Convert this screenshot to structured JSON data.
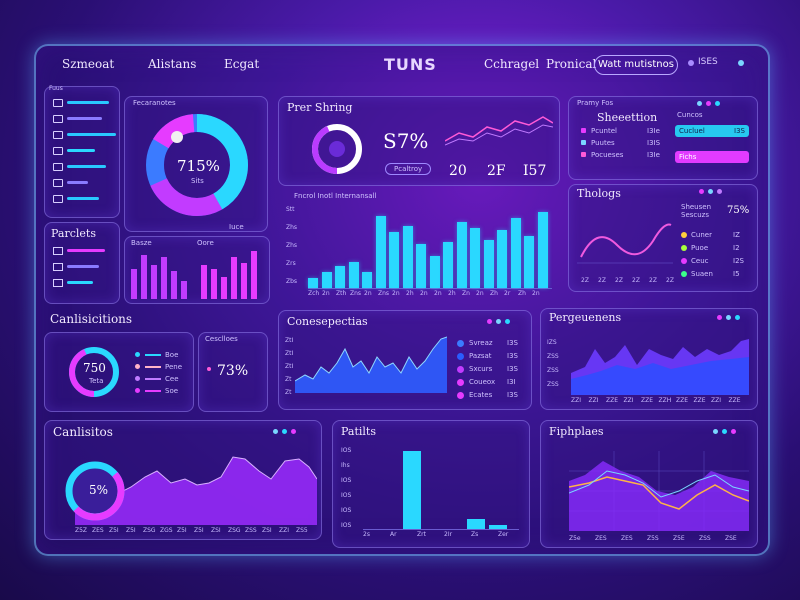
{
  "nav": {
    "left": [
      "Szmeoat",
      "Alistans",
      "Ecgat"
    ],
    "brand": "TUNS",
    "right": [
      "Cchragel",
      "Pronical"
    ],
    "button": "Watt mutistnos",
    "mini": "ISES"
  },
  "sidebar": {
    "items": [
      "",
      "",
      "",
      "",
      "",
      "",
      ""
    ],
    "title": "Fuus"
  },
  "donut_panel": {
    "title": "Fecaranotes",
    "value": "715%",
    "sub": "Sits",
    "foot": "Iuce"
  },
  "revenue_panel": {
    "title": "Prer Shring",
    "big": "S7%",
    "btn": "Pcaltroy",
    "stats": [
      "20",
      "2F",
      "I57"
    ]
  },
  "bar_panel": {
    "title": "Fncrol  Inotl  Internansall",
    "xlabels": [
      "Zch",
      "2n",
      "Zth",
      "Zns",
      "2n",
      "Zns",
      "2n",
      "2h",
      "2n",
      "2n",
      "2h",
      "Zn",
      "2n",
      "Zh",
      "2r",
      "Zh",
      "2n"
    ],
    "ylabels": [
      "Stt",
      "Zhs",
      "Zhs",
      "Zrs",
      "Zbs"
    ]
  },
  "profile_panel": {
    "title": "Pramy Fos",
    "heading": "Sheeettion",
    "rows": [
      [
        "Pcuntel",
        "I3Ie"
      ],
      [
        "Puutes",
        "I3IS"
      ],
      [
        "Pocueses",
        "I3Ie"
      ]
    ],
    "side_title": "Cuncos",
    "pill1": "Cucluel",
    "pill1v": "I3S",
    "pill2": "Fichs"
  },
  "trend_panel": {
    "title": "Thologs",
    "legend_title": "Sheusen",
    "legend_sub": "Sescuzs",
    "pct": "75%",
    "rows": [
      [
        "Cuner",
        "IZ"
      ],
      [
        "Puoe",
        "I2"
      ],
      [
        "Ceuc",
        "I2S"
      ],
      [
        "Suaen",
        "I5"
      ]
    ],
    "xlabels": [
      "2Z",
      "2Z",
      "2Z",
      "2Z",
      "2Z",
      "2Z"
    ]
  },
  "panels_small": {
    "title": "Parclets",
    "bars_left": "Basze",
    "bars_right": "Oore"
  },
  "conditions": {
    "title": "Canlisicitions",
    "value": "750",
    "sub": "Teta",
    "legend": [
      [
        "Boe"
      ],
      [
        "Pene"
      ],
      [
        "Cee"
      ],
      [
        "Soe"
      ]
    ],
    "card_title": "Cesclloes",
    "card_value": "73%"
  },
  "comp_panel": {
    "title": "Conesepectias",
    "ylabels": [
      "ZtI",
      "ZtI",
      "ZtI",
      "Zt",
      "Zt"
    ],
    "legend": [
      [
        "Svreaz",
        "I3S"
      ],
      [
        "Pazsat",
        "I3S"
      ],
      [
        "Sxcurs",
        "I3S"
      ],
      [
        "Coueox",
        "I3I"
      ],
      [
        "Ecates",
        "I3S"
      ]
    ]
  },
  "perf_panel": {
    "title": "Pergeuenens",
    "ylabels": [
      "IZS",
      "ZSS",
      "ZSS",
      "ZSS"
    ],
    "xlabels": [
      "ZZI",
      "ZZI",
      "ZZE",
      "ZZI",
      "ZZE",
      "ZZH",
      "ZZE",
      "ZZE",
      "ZZI",
      "ZZE"
    ]
  },
  "cal_panel": {
    "title": "Canlisitos",
    "value": "5%",
    "xlabels": [
      "Z5Z",
      "ZES",
      "Z5I",
      "Z5I",
      "ZSG",
      "ZGS",
      "Z5I",
      "Z5I",
      "ZSI",
      "ZSG",
      "ZSS",
      "ZSI",
      "ZZI",
      "ZS5"
    ]
  },
  "purple_panel": {
    "title": "Patilts",
    "ylabels": [
      "IOS",
      "Ihs",
      "IOS",
      "IOS",
      "IOS",
      "IOS"
    ],
    "xlabels": [
      "2s",
      "Ar",
      "Zrt",
      "2Ir",
      "Zs",
      "Zer"
    ]
  },
  "phases_panel": {
    "title": "Fiphplaes",
    "xlabels": [
      "Z5e",
      "ZES",
      "ZES",
      "Z5S",
      "Z5E",
      "ZSS",
      "ZSE"
    ]
  },
  "colors": {
    "cyan": "#29d8ff",
    "magenta": "#e63bff",
    "blue": "#3b7bff",
    "violet": "#8a3dff",
    "orange": "#ffb347"
  }
}
